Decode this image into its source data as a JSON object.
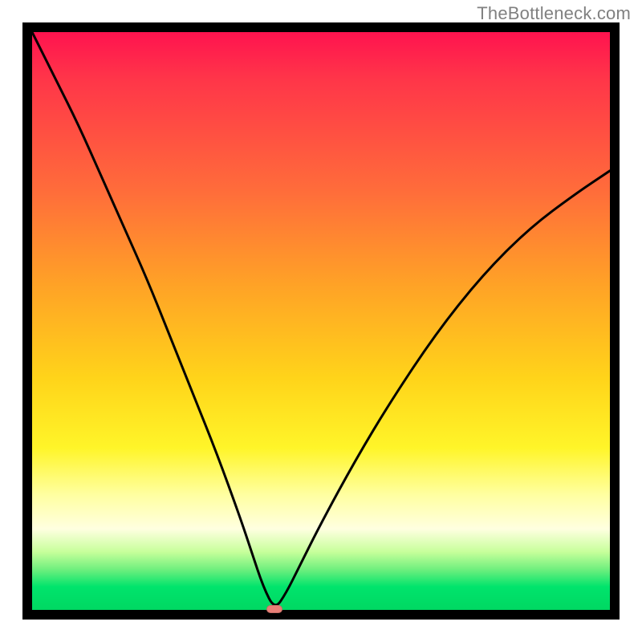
{
  "watermark": "TheBottleneck.com",
  "colors": {
    "frame_bg": "#ffffff",
    "border": "#000000",
    "curve": "#000000",
    "dip_marker": "#e97f77",
    "gradient": [
      "#ff134f",
      "#ff6e3a",
      "#ffd41a",
      "#ffffe0",
      "#00d862"
    ]
  },
  "chart_data": {
    "type": "line",
    "title": "",
    "xlabel": "",
    "ylabel": "",
    "xlim": [
      0,
      100
    ],
    "ylim": [
      0,
      100
    ],
    "grid": false,
    "legend": false,
    "dip_x": 42,
    "dip_marker": {
      "x": 42,
      "y": 0,
      "color": "#e97f77"
    },
    "series": [
      {
        "name": "bottleneck-curve",
        "x": [
          0,
          4,
          8,
          12,
          16,
          20,
          24,
          28,
          32,
          36,
          38,
          40,
          42,
          44,
          46,
          50,
          56,
          62,
          70,
          78,
          86,
          94,
          100
        ],
        "y": [
          100,
          92,
          84,
          75,
          66,
          57,
          47,
          37,
          27,
          16,
          10,
          4,
          0,
          3,
          7,
          15,
          26,
          36,
          48,
          58,
          66,
          72,
          76
        ]
      }
    ]
  }
}
